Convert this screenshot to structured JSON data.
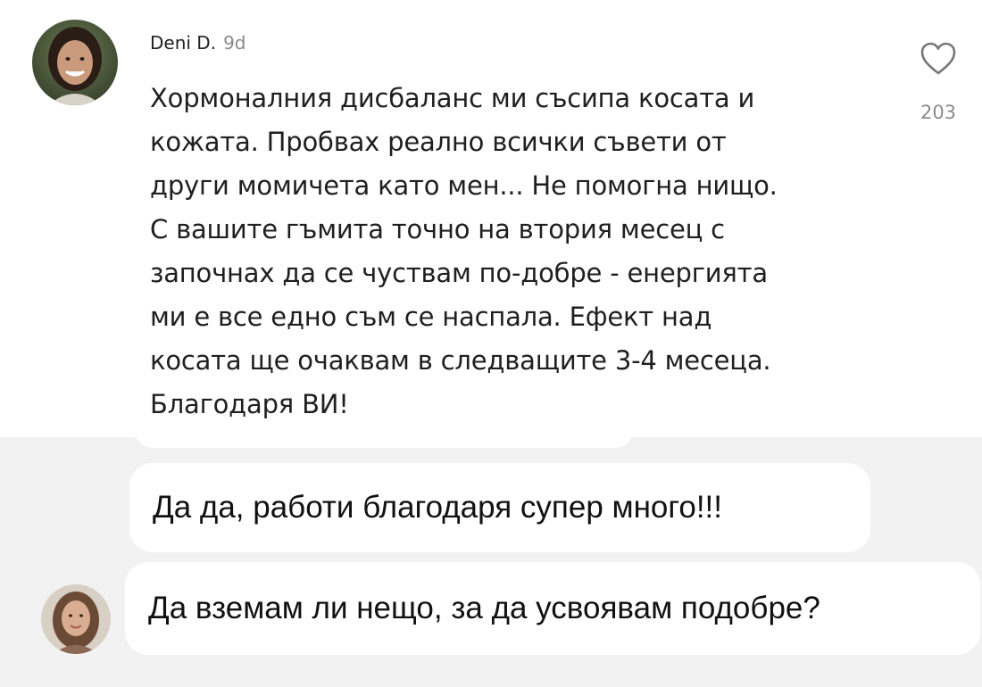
{
  "comment": {
    "author": "Deni D.",
    "age": "9d",
    "text": "Хормоналния дисбаланс ми съсипа косата и\nкожата. Пробвах реално всички съвети от\nдруги момичета като мен... Не помогна нищо.\nС вашите гъмита точно на втория месец с\nзапочнах да се чуствам по-добре - енергията\nми е все едно съм се наспала. Ефект над\nкосата ще очаквам в следващите 3-4 месеца.\nБлагодаря ВИ!",
    "likes": "203",
    "like_icon": "heart-outline-icon"
  },
  "replies": [
    {
      "text": "Да да, работи благодаря супер много!!!"
    },
    {
      "text": "Да вземам ли нещо, за да усвоявам подобре?"
    }
  ],
  "colors": {
    "reply_area_bg": "#f2f2f2",
    "bubble_bg": "#ffffff",
    "muted_text": "#8a8a8a"
  }
}
